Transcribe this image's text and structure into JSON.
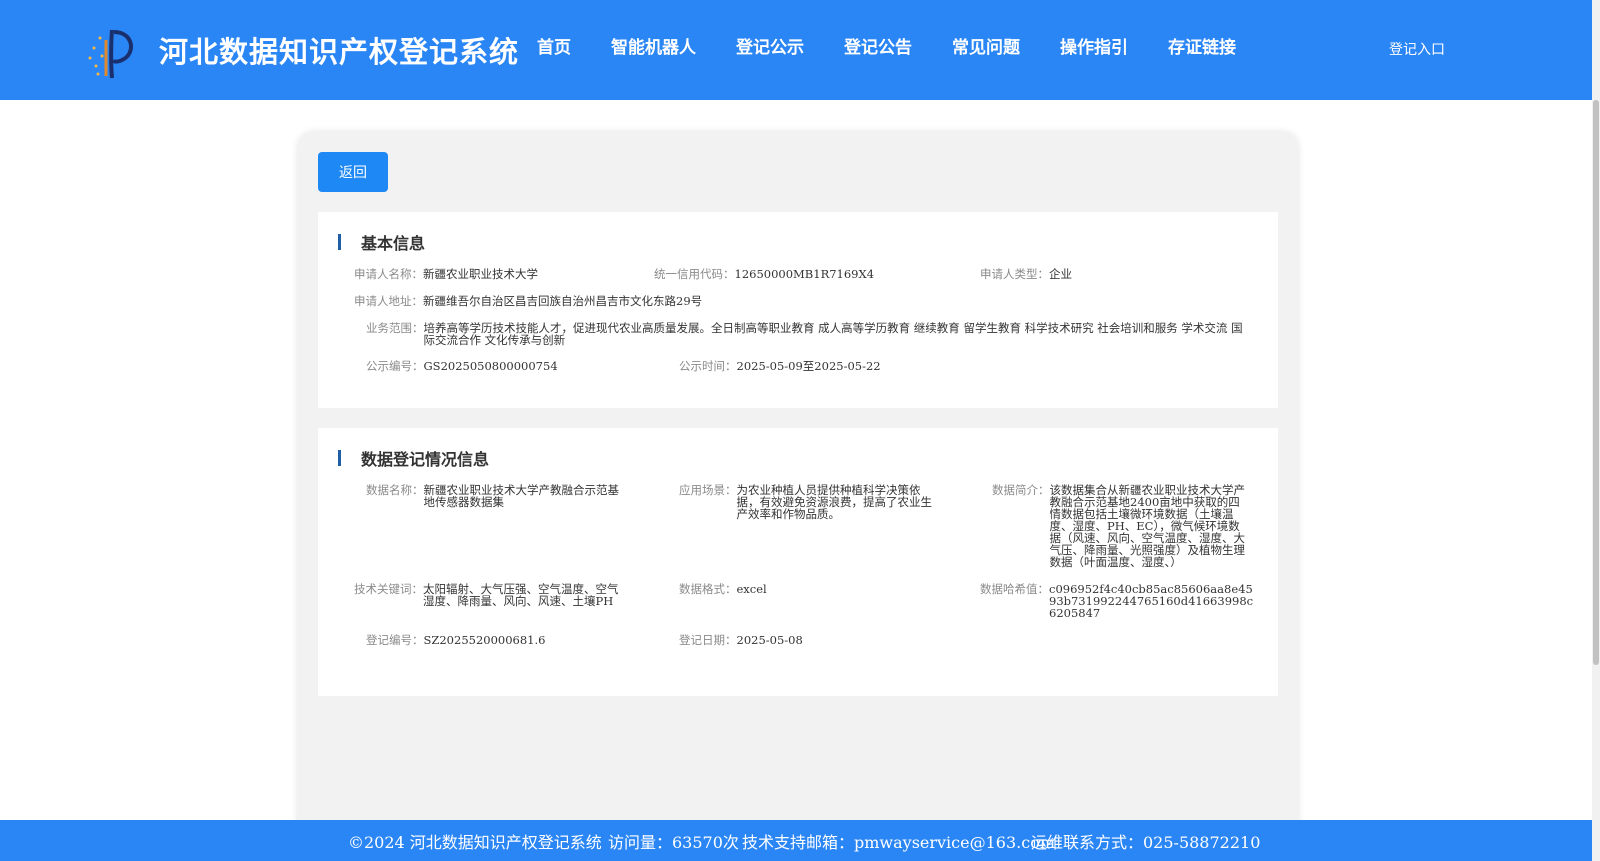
{
  "header": {
    "title": "河北数据知识产权登记系统",
    "nav": [
      "首页",
      "智能机器人",
      "登记公示",
      "登记公告",
      "常见问题",
      "操作指引",
      "存证链接"
    ],
    "login": "登记入口"
  },
  "back_button": "返回",
  "basic": {
    "title": "基本信息",
    "applicant_name_label": "申请人名称：",
    "applicant_name": "新疆农业职业技术大学",
    "credit_code_label": "统一信用代码：",
    "credit_code": "12650000MB1R7169X4",
    "applicant_type_label": "申请人类型：",
    "applicant_type": "企业",
    "address_label": "申请人地址：",
    "address": "新疆维吾尔自治区昌吉回族自治州昌吉市文化东路29号",
    "scope_label": "业务范围：",
    "scope": "培养高等学历技术技能人才，促进现代农业高质量发展。全日制高等职业教育 成人高等学历教育 继续教育 留学生教育 科学技术研究 社会培训和服务 学术交流 国际交流合作 文化传承与创新",
    "notice_no_label": "公示编号：",
    "notice_no": "GS2025050800000754",
    "notice_time_label": "公示时间：",
    "notice_time": "2025-05-09至2025-05-22"
  },
  "data_info": {
    "title": "数据登记情况信息",
    "name_label": "数据名称：",
    "name": "新疆农业职业技术大学产教融合示范基地传感器数据集",
    "scenario_label": "应用场景：",
    "scenario": "为农业种植人员提供种植科学决策依据，有效避免资源浪费，提高了农业生产效率和作物品质。",
    "intro_label": "数据简介：",
    "intro": "该数据集合从新疆农业职业技术大学产教融合示范基地2400亩地中获取的四情数据包括土壤微环境数据（土壤温度、湿度、PH、EC），微气候环境数据（风速、风向、空气温度、湿度、大气压、降雨量、光照强度）及植物生理数据（叶面温度、湿度、）",
    "keywords_label": "技术关键词：",
    "keywords": "太阳辐射、大气压强、空气温度、空气湿度、降雨量、风向、风速、土壤PH",
    "format_label": "数据格式：",
    "format": "excel",
    "hash_label": "数据哈希值：",
    "hash": "c096952f4c40cb85ac85606aa8e4593b731992244765160d41663998c6205847",
    "reg_no_label": "登记编号：",
    "reg_no": "SZ2025520000681.6",
    "reg_date_label": "登记日期：",
    "reg_date": "2025-05-08"
  },
  "footer": {
    "copyright": "©2024 河北数据知识产权登记系统",
    "visits": "访问量：63570次",
    "email": "技术支持邮箱：pmwayservice@163.com",
    "contact": "运维联系方式：025-58872210"
  }
}
